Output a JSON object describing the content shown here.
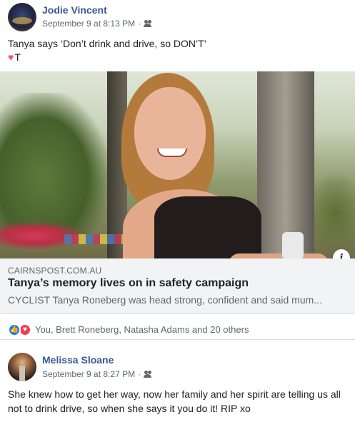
{
  "post": {
    "author": "Jodie Vincent",
    "date": "September 9 at 8:13 PM",
    "separator": "·",
    "audience_icon": "friends-icon",
    "text_line1": "Tanya says ‘Don’t drink and drive, so DON’T’",
    "text_line2_suffix": "T",
    "text_line2_icon": "heart-icon"
  },
  "link_preview": {
    "domain": "CAIRNSPOST.COM.AU",
    "title": "Tanya’s memory lives on in safety campaign",
    "description": "CYCLIST Tanya Roneberg was head strong, confident and said mum...",
    "info_icon": "i"
  },
  "reactions": {
    "icons": [
      "like-icon",
      "love-icon"
    ],
    "like_glyph": "👍",
    "love_glyph": "♥",
    "summary": "You, Brett Roneberg, Natasha Adams and 20 others"
  },
  "comment": {
    "author": "Melissa Sloane",
    "date": "September 9 at 8:27 PM",
    "separator": "·",
    "audience_icon": "friends-icon",
    "text": "She knew how to get her way, now her family and her spirit are telling us all not to drink drive, so when she says it you do it! RIP xo"
  },
  "colors": {
    "name_link": "#385898",
    "meta_text": "#606770",
    "like_blue": "#1877f2",
    "love_red": "#f33e58",
    "card_bg": "#f2f3f5"
  }
}
